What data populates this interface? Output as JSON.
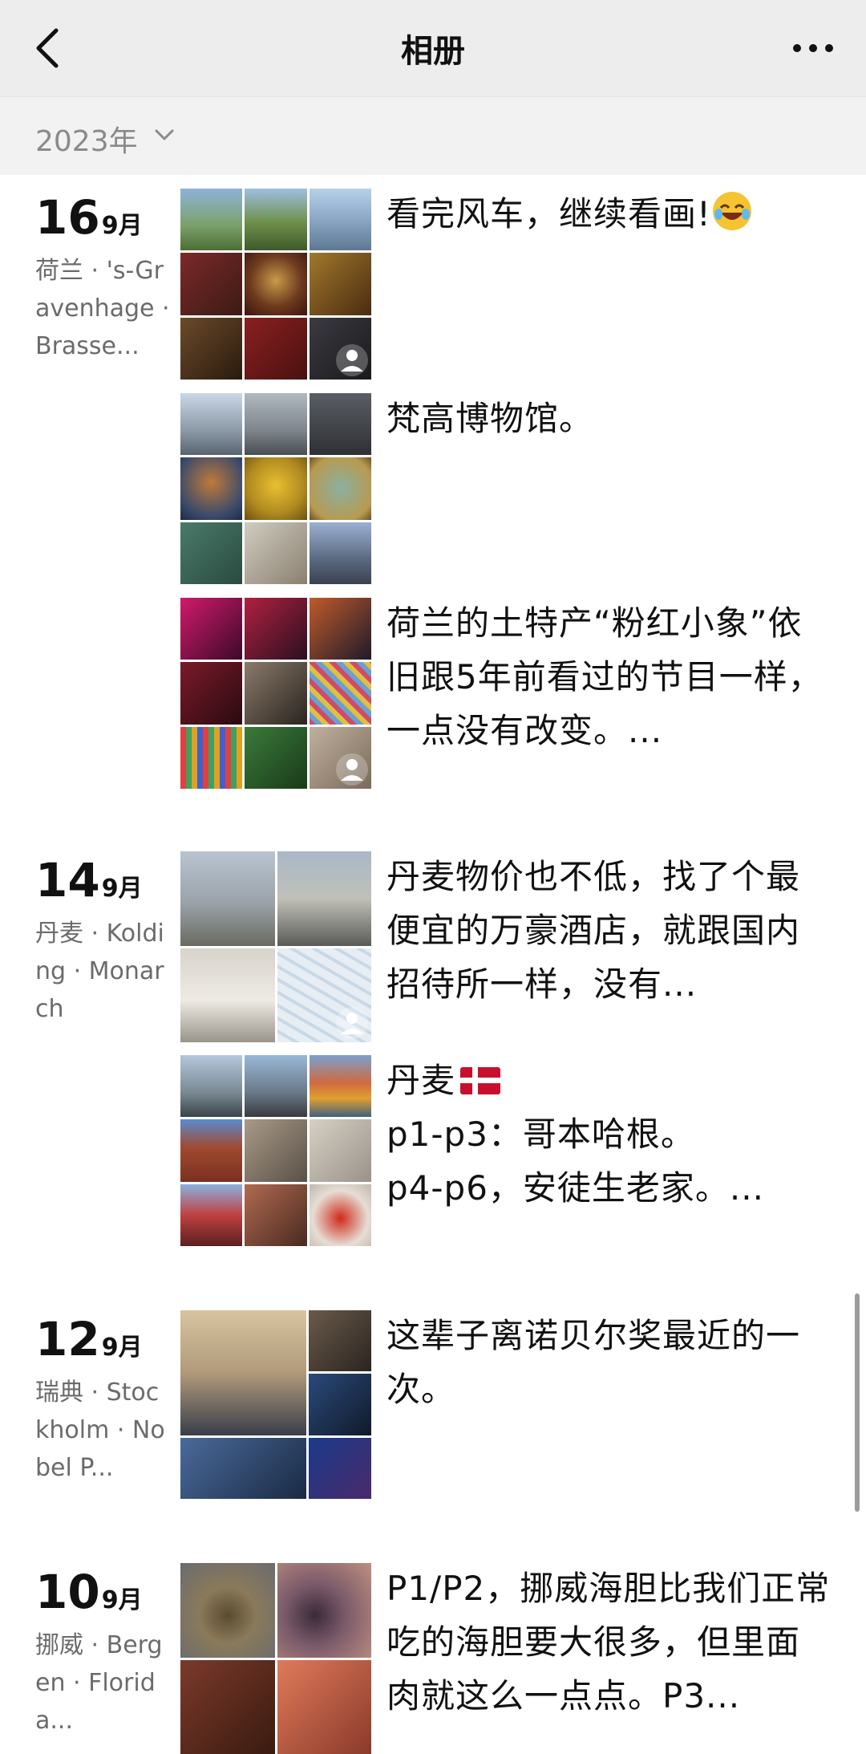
{
  "navbar": {
    "title": "相册"
  },
  "year_filter": {
    "label": "2023年"
  },
  "groups": [
    {
      "day": "16",
      "month": "9月",
      "location": "荷兰 · 's-Gravenhage · Brasse...",
      "posts": [
        {
          "caption": "看完风车，继续看画!",
          "emoji": "laughing-face-emoji"
        },
        {
          "caption": "梵高博物馆。"
        },
        {
          "caption": "荷兰的土特产“粉红小象”依旧跟5年前看过的节目一样，一点没有改变。..."
        }
      ]
    },
    {
      "day": "14",
      "month": "9月",
      "location": "丹麦 · Kolding · Monarch",
      "posts": [
        {
          "caption": "丹麦物价也不低，找了个最便宜的万豪酒店，就跟国内招待所一样，没有..."
        },
        {
          "caption_line1": "丹麦",
          "emoji": "denmark-flag-emoji",
          "caption_line2": "p1-p3：哥本哈根。",
          "caption_line3": "p4-p6，安徒生老家。..."
        }
      ]
    },
    {
      "day": "12",
      "month": "9月",
      "location": "瑞典 · Stockholm · Nobel P...",
      "posts": [
        {
          "caption": "这辈子离诺贝尔奖最近的一次。"
        }
      ]
    },
    {
      "day": "10",
      "month": "9月",
      "location": "挪威 · Bergen · Florida...",
      "posts": [
        {
          "caption": "P1/P2，挪威海胆比我们正常吃的海胆要大很多，但里面肉就这么一点点。P3..."
        }
      ]
    }
  ],
  "colors": {
    "navbar_bg": "#ededed",
    "year_bar_bg": "#f2f2f2",
    "text_primary": "#111111",
    "text_secondary": "#6b6b6b"
  }
}
